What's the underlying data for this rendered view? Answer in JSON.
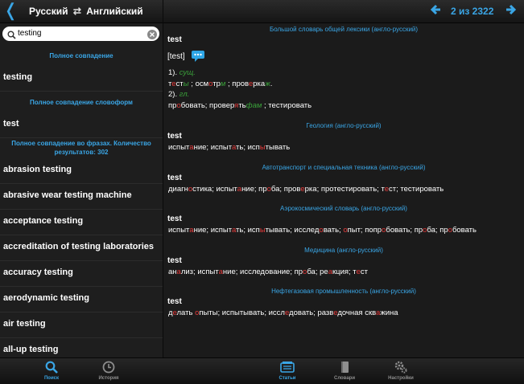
{
  "header": {
    "back_icon": "chevron-left-icon",
    "direction_from": "Русский",
    "swap_symbol": "⇄",
    "direction_to": "Английский",
    "pager": "2 из 2322",
    "accent": "#3aa6e6"
  },
  "search": {
    "value": "testing"
  },
  "left": {
    "exact_header": "Полное совпадение",
    "exact_item": "testing",
    "wordform_header": "Полное совпадение словоформ",
    "wordform_item": "test",
    "phrases_header_1": "Полное совпадение во фразах. Количество",
    "phrases_header_2": "результатов: 302",
    "phrases": [
      "abrasion testing",
      "abrasive wear testing machine",
      "acceptance testing",
      "accreditation of testing laboratories",
      "accuracy testing",
      "aerodynamic testing",
      "air testing",
      "all-up testing"
    ]
  },
  "article": {
    "general": {
      "title": "Большой словарь общей лексики (англо-русский)",
      "headword": "test",
      "transcription": "[test]",
      "n1": "1).",
      "pos1": "сущ.",
      "noun_parts": [
        "т",
        "е",
        "ст",
        "ы",
        " ; осм",
        "о",
        "тр",
        "м",
        " ; пров",
        "е",
        "рка",
        "ж",
        "."
      ],
      "n2": "2).",
      "pos2": "гл.",
      "verb_parts": [
        "пр",
        "о",
        "бовать; провер",
        "я",
        "ть",
        "фам",
        " ; тестировать"
      ]
    },
    "geology": {
      "title": "Геология (англо-русский)",
      "headword": "test",
      "parts": [
        "испыт",
        "а",
        "ние; испыт",
        "а",
        "ть; исп",
        "ы",
        "тывать"
      ]
    },
    "auto": {
      "title": "Автотранспорт и специальная техника (англо-русский)",
      "headword": "test",
      "parts": [
        "диагн",
        "о",
        "стика; испыт",
        "а",
        "ние; пр",
        "о",
        "ба; пров",
        "е",
        "рка; протестировать; т",
        "е",
        "ст; тестировать"
      ]
    },
    "aero": {
      "title": "Аэрокосмический словарь (англо-русский)",
      "headword": "test",
      "parts": [
        "испыт",
        "а",
        "ние; испыт",
        "а",
        "ть; исп",
        "ы",
        "тывать; исслед",
        "о",
        "вать; ",
        "о",
        "пыт; попр",
        "о",
        "бовать; пр",
        "о",
        "ба; пр",
        "о",
        "бовать"
      ]
    },
    "medicine": {
      "title": "Медицина (англо-русский)",
      "headword": "test",
      "parts": [
        "ан",
        "а",
        "лиз; испыт",
        "а",
        "ние; исследование; пр",
        "о",
        "ба; ре",
        "а",
        "кция; т",
        "е",
        "ст"
      ]
    },
    "oil": {
      "title": "Нефтегазовая промышленность (англо-русский)",
      "headword": "test",
      "parts": [
        "д",
        "е",
        "лать ",
        "о",
        "пыты; испытывать; иссл",
        "е",
        "довать; разв",
        "е",
        "дочная скв",
        "а",
        "жина"
      ]
    }
  },
  "tabs": {
    "search": "Поиск",
    "history": "История",
    "articles": "Статьи",
    "dictionaries": "Словари",
    "settings": "Настройки"
  }
}
